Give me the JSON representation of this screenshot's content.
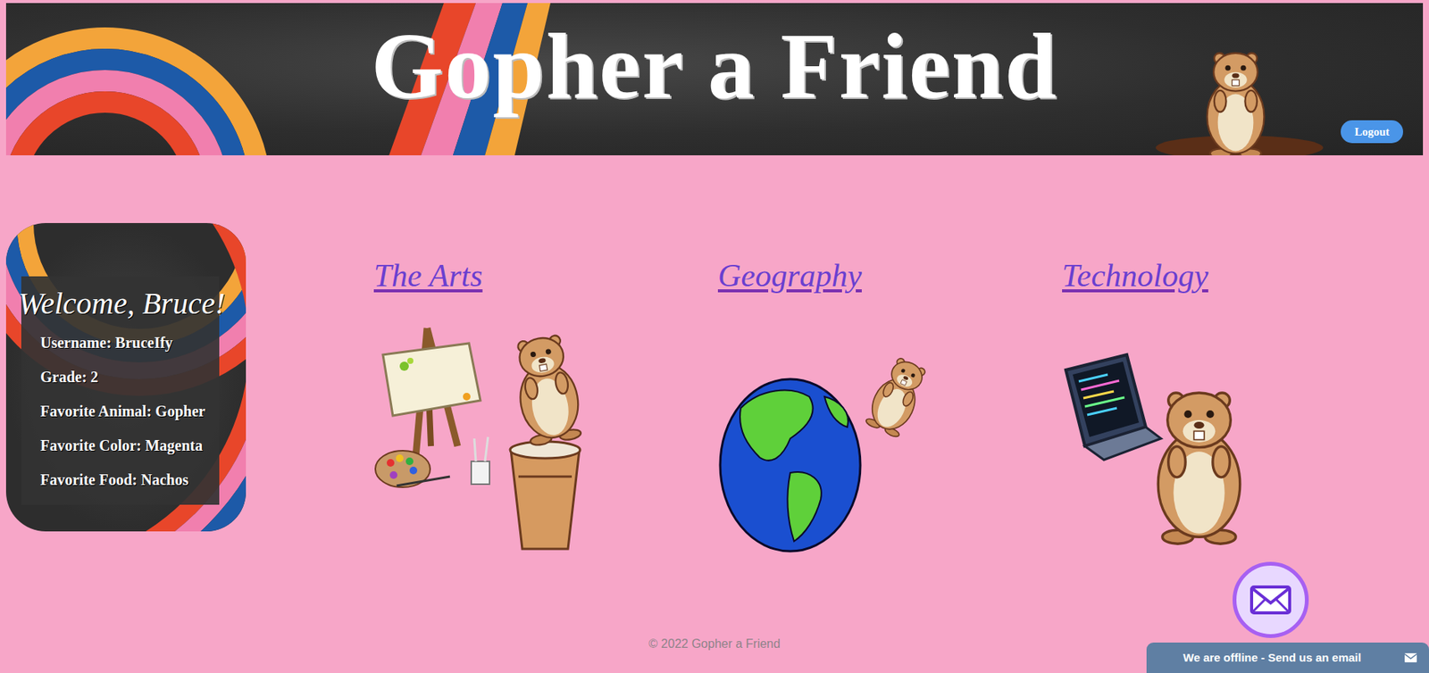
{
  "header": {
    "title": "Gopher a Friend",
    "logout": "Logout"
  },
  "profile": {
    "welcome": "Welcome, Bruce!",
    "fields": [
      "Username: BruceIfy",
      "Grade: 2",
      "Favorite Animal: Gopher",
      "Favorite Color: Magenta",
      "Favorite Food: Nachos"
    ]
  },
  "categories": [
    {
      "label": "The Arts"
    },
    {
      "label": "Geography"
    },
    {
      "label": "Technology"
    }
  ],
  "footer": "© 2022 Gopher a Friend",
  "chat": {
    "label": "We are offline - Send us an email"
  }
}
